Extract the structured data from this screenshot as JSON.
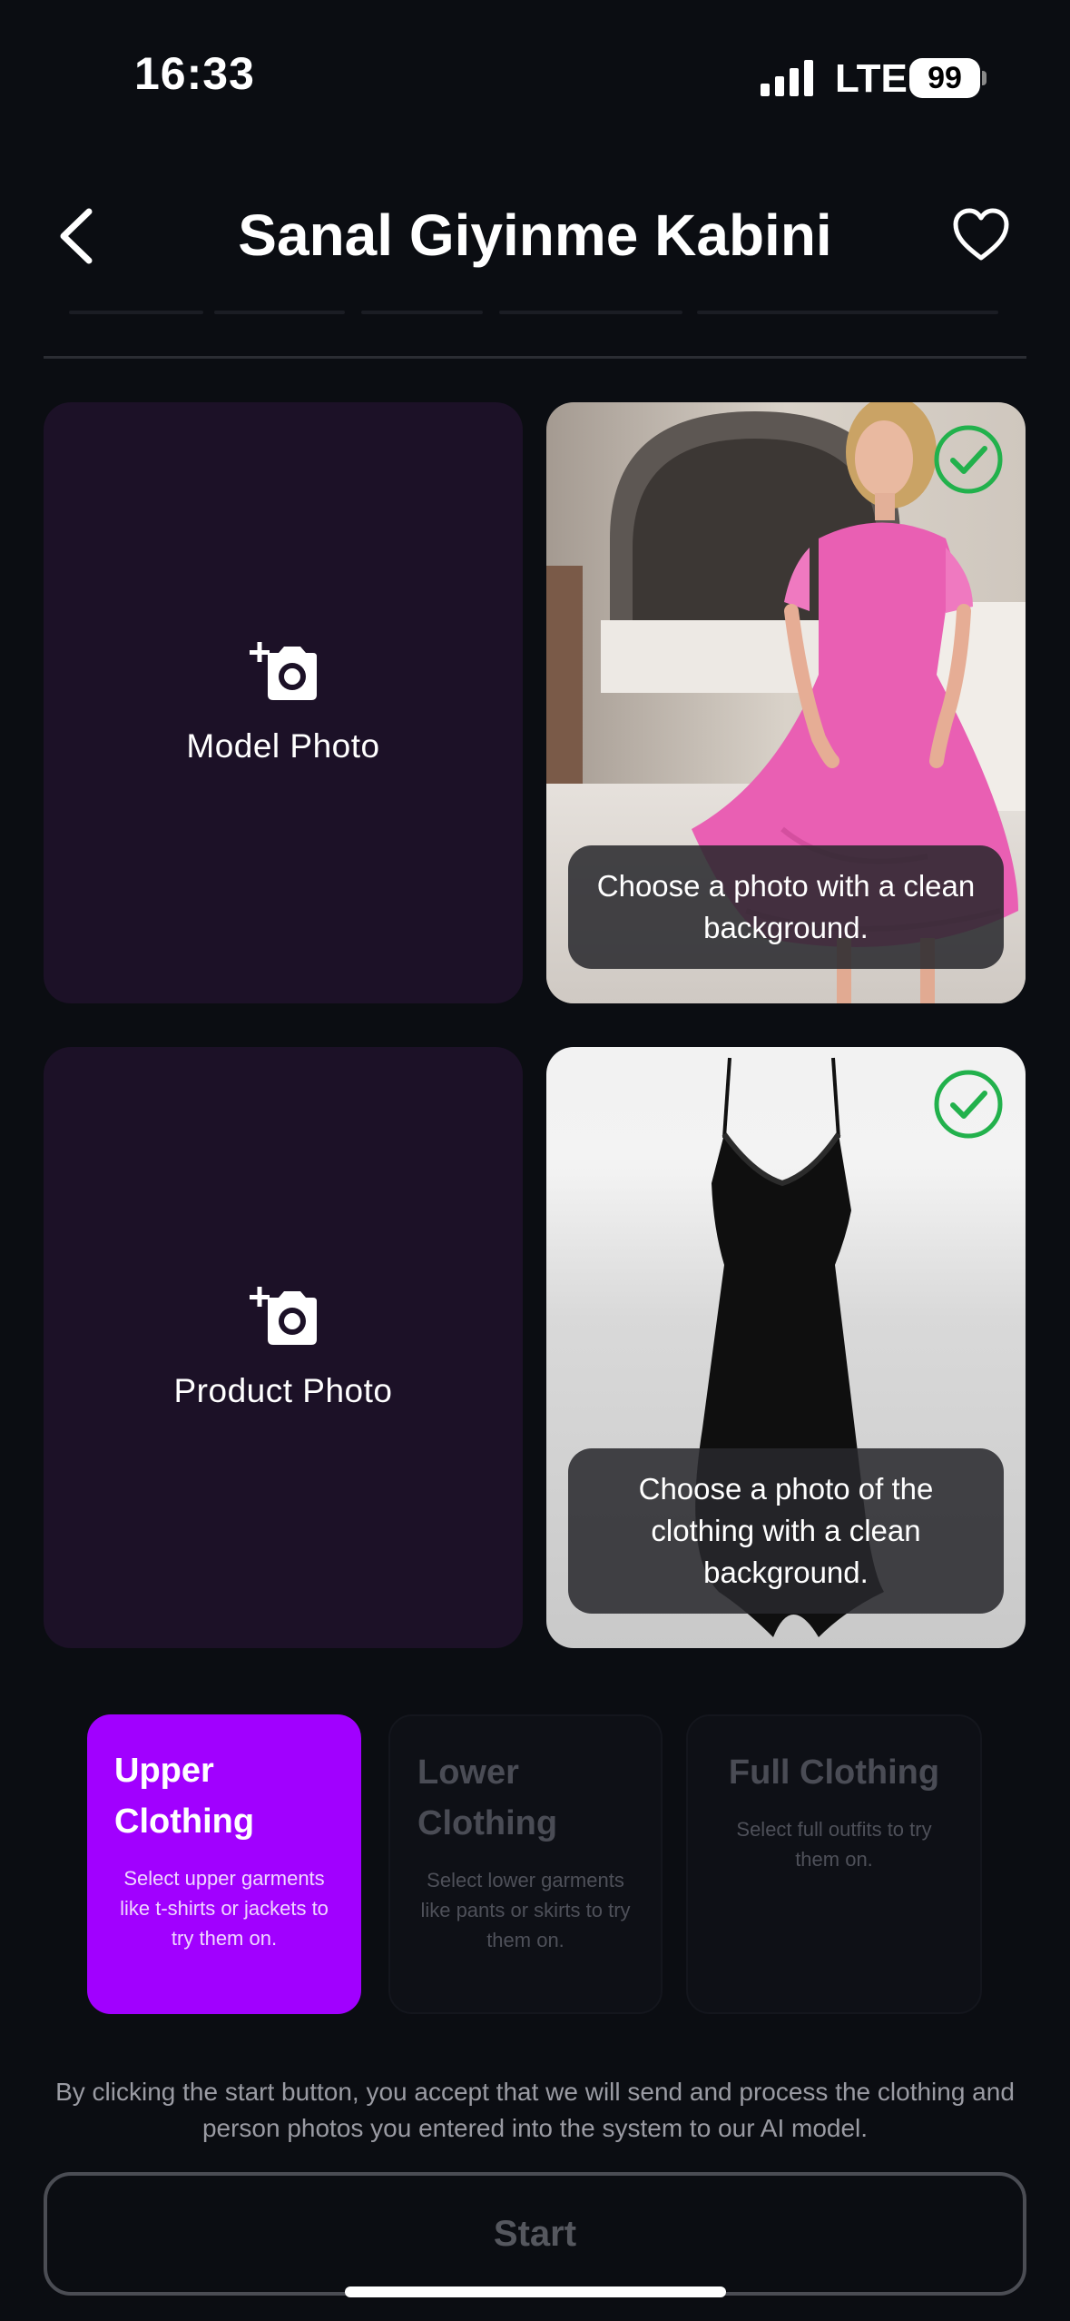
{
  "status_bar": {
    "time": "16:33",
    "network": "LTE",
    "battery": "99"
  },
  "header": {
    "title": "Sanal Giyinme Kabini",
    "back_icon": "chevron-left-icon",
    "favorite_icon": "heart-icon"
  },
  "model_section": {
    "upload_label": "Model Photo",
    "upload_icon": "add-photo-icon",
    "example_tip": "Choose a photo with a clean background."
  },
  "product_section": {
    "upload_label": "Product Photo",
    "upload_icon": "add-photo-icon",
    "example_tip": "Choose a photo of the clothing with a clean background."
  },
  "categories": [
    {
      "title": "Upper Clothing",
      "description": "Select upper garments like t-shirts or jackets to try them on.",
      "selected": true
    },
    {
      "title": "Lower Clothing",
      "description": "Select lower garments like pants or skirts to try them on.",
      "selected": false
    },
    {
      "title": "Full Clothing",
      "description": "Select full outfits to try them on.",
      "selected": false
    }
  ],
  "disclaimer": "By clicking the start button, you accept that we will send and process the clothing and person photos you entered into the system to our AI model.",
  "start_button": "Start",
  "colors": {
    "background": "#0b0d12",
    "accent": "#a100ff",
    "upload_card": "#1c1127",
    "check": "#22b14c"
  }
}
